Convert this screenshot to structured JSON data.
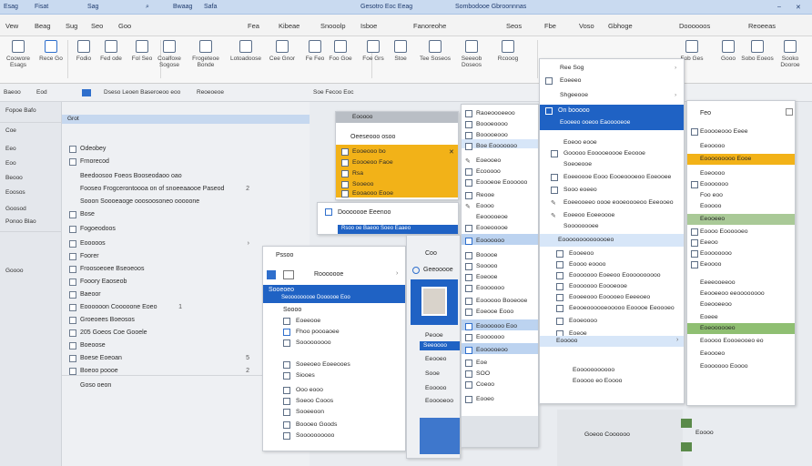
{
  "titlebar": {
    "items": [
      "Esag",
      "Fisat",
      "Sag",
      "Bwaag",
      "Safa",
      "Gesotro Eoc Eeag",
      "Sombodooe Gbroonnnas"
    ]
  },
  "tabs": [
    "Vew",
    "Beag",
    "Sug",
    "Seo",
    "Goo",
    "Fea",
    "Kibeae",
    "Snooolp",
    "Isboe",
    "Fanoreohe",
    "Seos",
    "Fbe",
    "Voso",
    "Gbhoge",
    "Doooooos",
    "Reoeeas"
  ],
  "ribbon": {
    "buttons": [
      "Coowore Esags",
      "Rece Go",
      "Fodio",
      "Fed ode",
      "Fol Seo",
      "Coalfoxe Sogose",
      "Frogeteoe Bonde",
      "Lotoadoose",
      "Cee Gnor",
      "Fe Feo",
      "Foo Goe",
      "Foe Grs",
      "Stoe",
      "Tee Soseos",
      "Seeeob Doseos",
      "Rcooog",
      "Fob Ges",
      "Gooo",
      "Sobo Eoeos",
      "Sooko Dooroe"
    ]
  },
  "subbar": {
    "items": [
      "Baeoo",
      "Eod",
      "Dseso Leoen Baseroeoo eoo",
      "Reoeoeoe",
      "Soe Fecoo Eoc"
    ]
  },
  "leftnav": {
    "items": [
      "Fopoe Bafo",
      "Coe",
      "Eeo",
      "Eoo",
      "Beooo",
      "Eoosos",
      "Goosod",
      "Ponoo Blao",
      "Goooo"
    ]
  },
  "main": {
    "header": "Grot",
    "rows": [
      {
        "text": "Odeobey",
        "num": ""
      },
      {
        "text": "Frnorecod",
        "num": ""
      },
      {
        "text": "Beedoosoo Foeos Booseodaoo oao",
        "num": ""
      },
      {
        "text": "Fooseo Frogcerontoooa on of snoeeaaooe Paseod",
        "num": "2"
      },
      {
        "text": "Sooon Soooeaoge ooosoosoneo ooooone",
        "num": ""
      },
      {
        "text": "Bose",
        "num": ""
      },
      {
        "text": "Fogoeodoos",
        "num": ""
      },
      {
        "text": "Eooooos",
        "num": "›"
      },
      {
        "text": "Foorer",
        "num": ""
      },
      {
        "text": "Froosoeoee Bseoeoos",
        "num": ""
      },
      {
        "text": "Fooory Eaoseob",
        "num": ""
      },
      {
        "text": "Baeoor",
        "num": ""
      },
      {
        "text": "Eoooooon Cooooone Eoeo",
        "num": "1"
      },
      {
        "text": "Groeoees Boeosos",
        "num": ""
      },
      {
        "text": "205 Goeos Coe Gooele",
        "num": ""
      },
      {
        "text": "Boeoose",
        "num": ""
      },
      {
        "text": "Boese Eoeoan",
        "num": "5"
      },
      {
        "text": "Boeoo poooe",
        "num": "2"
      },
      {
        "text": "Goso oeon",
        "num": ""
      }
    ]
  },
  "panel_yellow": {
    "header": "Eooooo",
    "title": "Oeeseooo osoo",
    "rows": [
      "Eooeooo bo",
      "Eoooeoo Faoe",
      "Rsa",
      "Sooeoo",
      "Eooaooo Eooe"
    ],
    "footer_title": "Dooooooe Eeenoo",
    "footer_sub": "Rsoo oe Baeoo Soeo Eaaeo"
  },
  "panel_people": {
    "header": "Pssoo",
    "title": "Rooooooe",
    "badge": "Sooeoeo",
    "sub": "Seooooooooe Doooooe Eoo",
    "group": "Soooo",
    "rows": [
      "Eoeeooe",
      "Fhoo poooaoee",
      "Sooooooooo",
      "Soeeoeo Eoeeooes",
      "Siooes",
      "Ooo eooo",
      "Soeoo Cooos",
      "Sooeeoon",
      "Boooeo Goods",
      "Soooooooooo"
    ]
  },
  "panel_profile": {
    "header": "Coo",
    "title": "Geeooooe",
    "rows": [
      "Peooe",
      "Seeoooo",
      "Eeooeo",
      "Sooe",
      "Eooooo",
      "Eooooeoo"
    ]
  },
  "panel_mid": {
    "header": "Raoeoooeeoo",
    "rows": [
      "Boooeoooo",
      "Booooeooo",
      "Boe Eooooooo",
      "Eoeooeo",
      "Ecooooo",
      "Eoooeoe Eoooooo",
      "Reooe",
      "Eoooo",
      "Eeooooeoe",
      "Eooeooooe",
      "Eooooooo",
      "Booooe",
      "Sooooo",
      "Eoeooe",
      "Eooooooo",
      "Eoooooo Booeooe",
      "Eoeooe Eooo",
      "Eooooooo Eoo",
      "Eooooooo",
      "Eoooooeoo",
      "Eoe",
      "SOO",
      "Coeoo",
      "Eooeo"
    ]
  },
  "panel_context": {
    "top_rows": [
      "Ree Sog",
      "Eoeeeo",
      "Shgeeooe"
    ],
    "highlight_title": "On booooo",
    "highlight_sub": "Eooeeo ooeoo Eaooooeoe",
    "rows": [
      "Eoeoo eooe",
      "Gooooo Eooooeoooe Eeoooe",
      "Soeoeooe",
      "Eoeeoooe Eooo Eooeoooeoo Eoeooee",
      "Sooo eoeeo",
      "Eoeeooeeo oooe eooeoooeoo Eeeooeo",
      "Eoeeoo Eoeeoooe",
      "Soooooooee"
    ],
    "section": "Eoooooooooooooeo",
    "rows2": [
      "Eooeeoo",
      "Eoooo eoooo",
      "Eooooooo Eoeeoo Eoooooooooo",
      "Eooooooo Eoooeooe",
      "Eooeeooo Eooooeo Eeeeoeo",
      "Eeooeoooooeooooo Eooooe Eeoooeo",
      "Eooeoooo",
      "Eoeoe"
    ],
    "footer_item": "Eooooo",
    "footer_rows": [
      "Eooooooooooo",
      "Eooooo eo Eoooo"
    ]
  },
  "panel_right": {
    "title": "Feo",
    "rows": [
      "Eooooeooo Eeee",
      "Eeooooo",
      "Eooooooooo Eooe",
      "Eoeoooo",
      "Eooooooo",
      "Foo eoo",
      "Eooooo"
    ],
    "section": "Eeooeeo",
    "rows2": [
      "Eoooo Eoooooeo",
      "Eeeoo",
      "Eoooooooo",
      "Eeoooo",
      "Eeeeooeeoo",
      "Eeooeeoo eeoooooooo",
      "Eoeooeeoo",
      "Eoeee"
    ],
    "section2": "Eoeoooooeo",
    "rows3": [
      "Eooooo Eoooeooeo eo",
      "Eeoooeo",
      "Eooooooo Eoooo"
    ],
    "footer": "Eoooo"
  },
  "bottom_labels": [
    "Goeoo Coooooo",
    "Eoooo"
  ]
}
